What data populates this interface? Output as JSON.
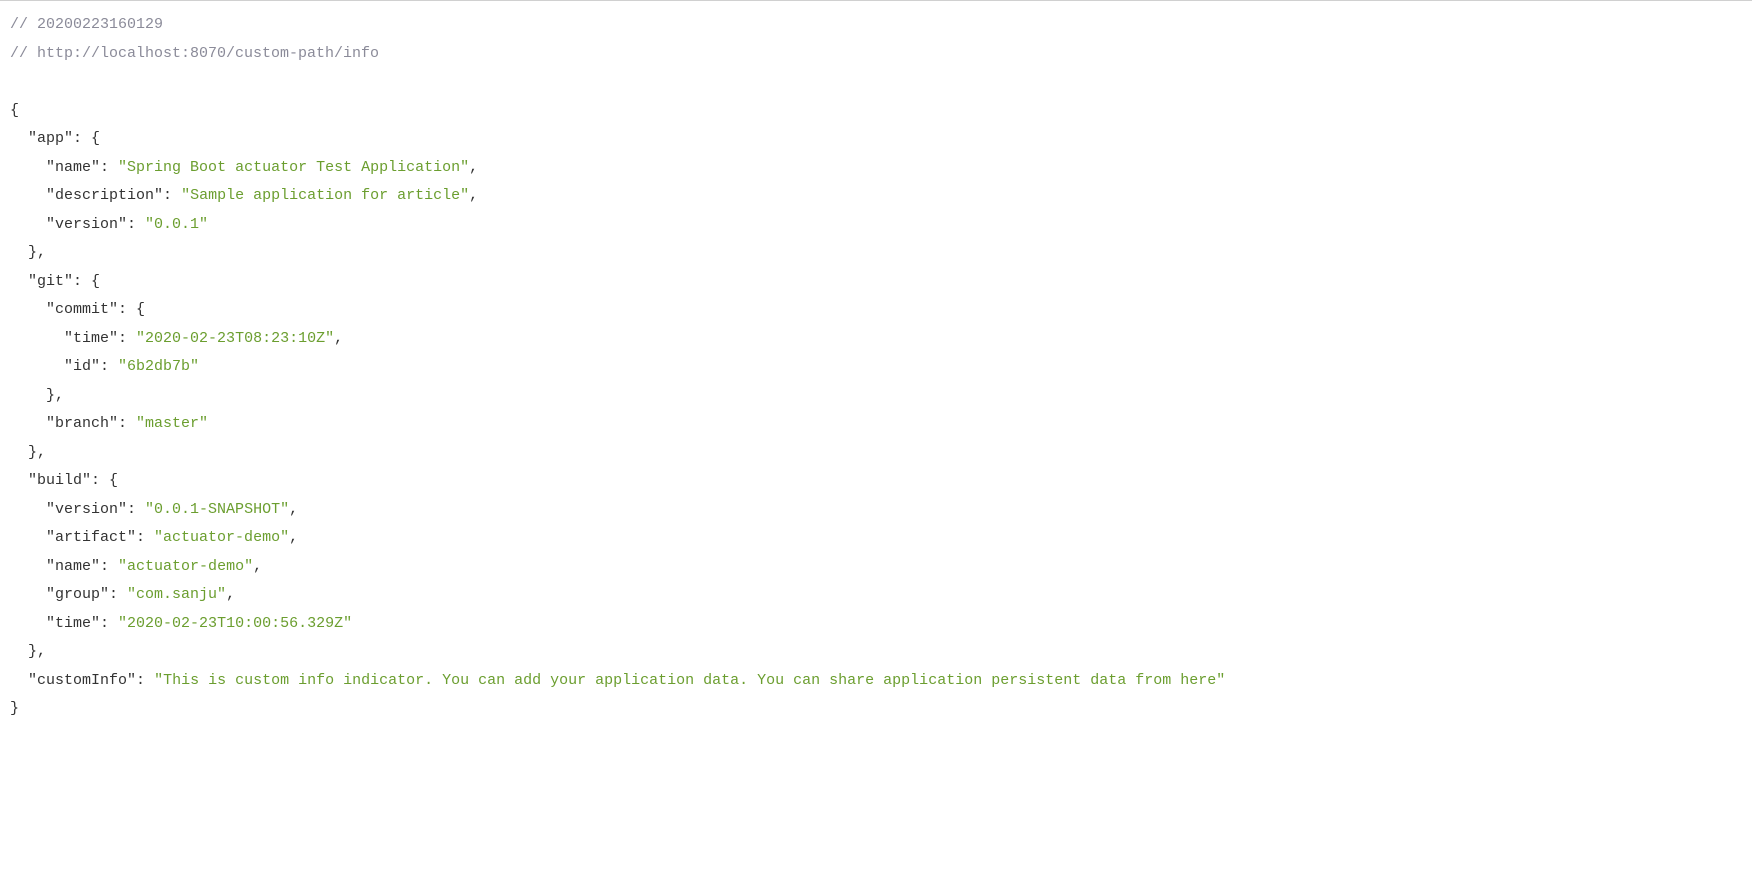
{
  "comments": {
    "ts": "// 20200223160129",
    "url": "// http://localhost:8070/custom-path/info"
  },
  "keys": {
    "app": "\"app\"",
    "app_name": "\"name\"",
    "app_description": "\"description\"",
    "app_version": "\"version\"",
    "git": "\"git\"",
    "git_commit": "\"commit\"",
    "git_commit_time": "\"time\"",
    "git_commit_id": "\"id\"",
    "git_branch": "\"branch\"",
    "build": "\"build\"",
    "build_version": "\"version\"",
    "build_artifact": "\"artifact\"",
    "build_name": "\"name\"",
    "build_group": "\"group\"",
    "build_time": "\"time\"",
    "customInfo": "\"customInfo\""
  },
  "values": {
    "app_name": "\"Spring Boot actuator Test Application\"",
    "app_description": "\"Sample application for article\"",
    "app_version": "\"0.0.1\"",
    "git_commit_time": "\"2020-02-23T08:23:10Z\"",
    "git_commit_id": "\"6b2db7b\"",
    "git_branch": "\"master\"",
    "build_version": "\"0.0.1-SNAPSHOT\"",
    "build_artifact": "\"actuator-demo\"",
    "build_name": "\"actuator-demo\"",
    "build_group": "\"com.sanju\"",
    "build_time": "\"2020-02-23T10:00:56.329Z\"",
    "customInfo": "\"This is custom info indicator. You can add your application data. You can share application persistent data from here\""
  },
  "punct": {
    "open_brace": "{",
    "close_brace": "}",
    "close_brace_comma": "},",
    "colon_space": ": ",
    "colon_open_brace": ": {",
    "comma": ","
  }
}
